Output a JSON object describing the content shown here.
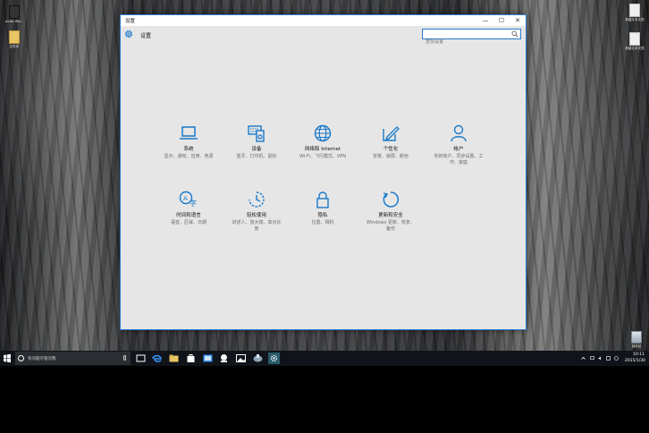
{
  "desktop": {
    "icons": [
      {
        "label": "Audio Wiz...",
        "icon": "app-file-icon"
      },
      {
        "label": "文件夹",
        "icon": "folder-icon"
      },
      {
        "label": "新建文本文档",
        "icon": "text-file-icon"
      },
      {
        "label": "新建文本文档",
        "icon": "text-file-icon"
      },
      {
        "label": "回收站",
        "icon": "recycle-bin-icon"
      }
    ]
  },
  "window": {
    "title": "设置",
    "minimize_label": "—",
    "maximize_label": "☐",
    "close_label": "✕",
    "header_title": "设置",
    "search_placeholder": "查找设置",
    "accent_color": "#1979ca"
  },
  "categories": [
    {
      "name": "系统",
      "desc": "显示、通知、应用、电源",
      "icon": "laptop-icon"
    },
    {
      "name": "设备",
      "desc": "蓝牙、打印机、鼠标",
      "icon": "keyboard-speaker-icon"
    },
    {
      "name": "网络和 Internet",
      "desc": "Wi-Fi、飞行模式、VPN",
      "icon": "globe-icon"
    },
    {
      "name": "个性化",
      "desc": "背景、锁屏、颜色",
      "icon": "pen-tablet-icon"
    },
    {
      "name": "帐户",
      "desc": "你的帐户、同步设置、工作、家庭",
      "icon": "person-icon"
    },
    {
      "name": "时间和语言",
      "desc": "语音、区域、日期",
      "icon": "time-language-icon"
    },
    {
      "name": "轻松使用",
      "desc": "讲述人、放大镜、高对比度",
      "icon": "ease-of-access-icon"
    },
    {
      "name": "隐私",
      "desc": "位置、相机",
      "icon": "lock-icon"
    },
    {
      "name": "更新和安全",
      "desc": "Windows 更新、恢复、备份",
      "icon": "update-icon"
    }
  ],
  "taskbar": {
    "search_placeholder": "有问题尽管问我",
    "apps": [
      "task-view-icon",
      "edge-icon",
      "file-explorer-icon",
      "store-icon",
      "app-icon",
      "app-icon",
      "photos-icon",
      "app-icon",
      "settings-icon"
    ],
    "clock_time": "10:11",
    "clock_date": "2015/1/30"
  }
}
